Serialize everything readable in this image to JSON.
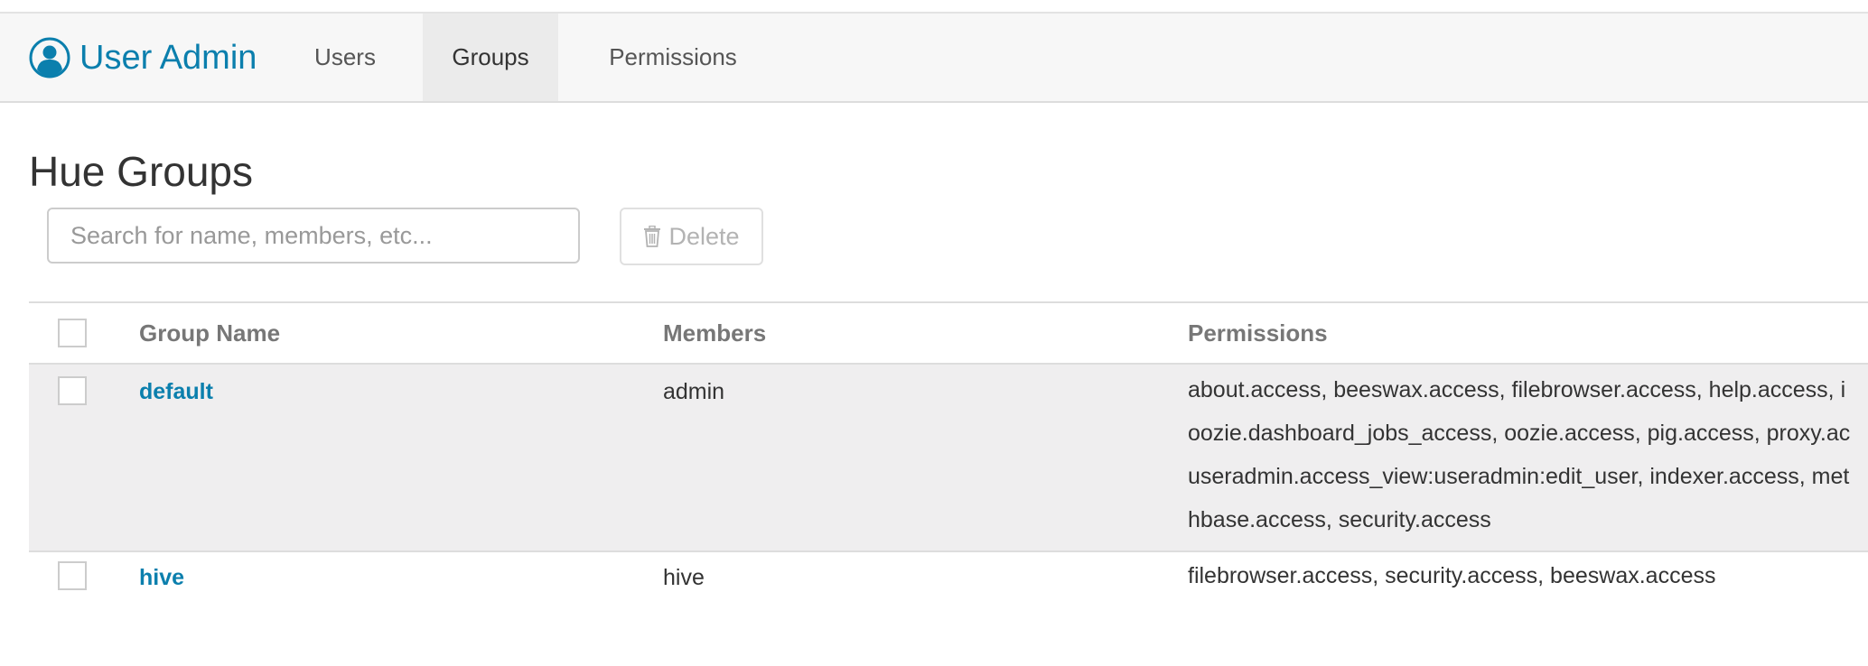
{
  "navbar": {
    "brand_title": "User Admin",
    "brand_icon": "user-circle-icon",
    "tabs": [
      {
        "label": "Users",
        "active": false
      },
      {
        "label": "Groups",
        "active": true
      },
      {
        "label": "Permissions",
        "active": false
      }
    ]
  },
  "page": {
    "title": "Hue Groups"
  },
  "toolbar": {
    "search_placeholder": "Search for name, members, etc...",
    "search_value": "",
    "delete_label": "Delete",
    "delete_icon": "trash-icon",
    "delete_disabled": true
  },
  "table": {
    "columns": [
      "Group Name",
      "Members",
      "Permissions"
    ],
    "rows": [
      {
        "name": "default",
        "members": "admin",
        "selected": true,
        "permissions_lines": [
          "about.access, beeswax.access, filebrowser.access, help.access, i",
          "oozie.dashboard_jobs_access, oozie.access, pig.access, proxy.ac",
          "useradmin.access_view:useradmin:edit_user, indexer.access, met",
          "hbase.access, security.access"
        ]
      },
      {
        "name": "hive",
        "members": "hive",
        "selected": false,
        "permissions_lines": [
          "filebrowser.access, security.access, beeswax.access"
        ]
      }
    ]
  },
  "colors": {
    "brand": "#0B7FAD",
    "navbar_bg": "#f7f7f7",
    "active_tab_bg": "#ebebeb",
    "selected_row_bg": "#efeeef"
  }
}
